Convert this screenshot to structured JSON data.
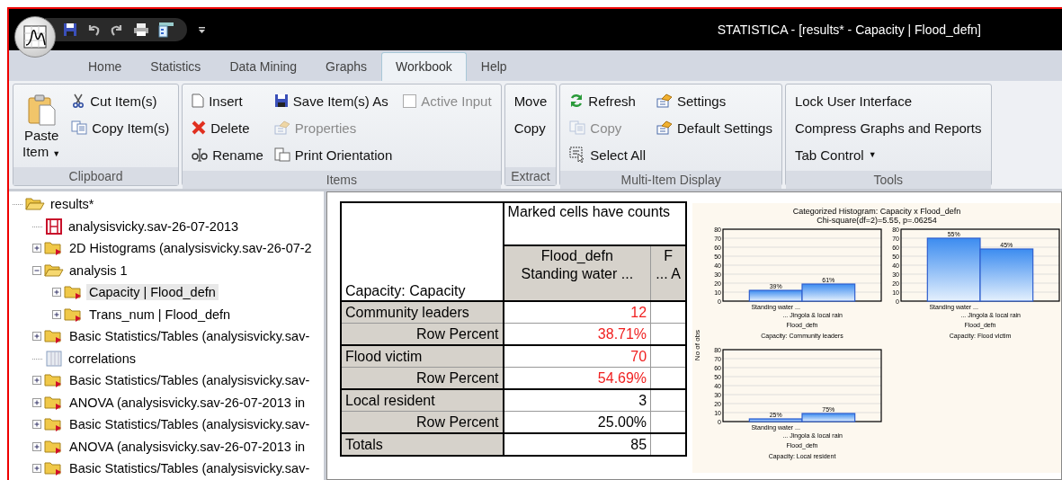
{
  "window": {
    "title": "STATISTICA - [results* - Capacity | Flood_defn]"
  },
  "quick_access": [
    {
      "kind": "save"
    },
    {
      "kind": "undo"
    },
    {
      "kind": "redo"
    },
    {
      "kind": "print"
    },
    {
      "kind": "panel"
    },
    {
      "kind": "customize"
    }
  ],
  "tabs": [
    {
      "label": "Home",
      "selected": false
    },
    {
      "label": "Statistics",
      "selected": false
    },
    {
      "label": "Data Mining",
      "selected": false
    },
    {
      "label": "Graphs",
      "selected": false
    },
    {
      "label": "Workbook",
      "selected": true
    },
    {
      "label": "Help",
      "selected": false
    }
  ],
  "ribbon": [
    {
      "label": "Clipboard",
      "columns": [
        [
          {
            "label": "Paste Item",
            "kind": "paste",
            "caret": "▼",
            "disabled": false
          }
        ],
        [
          {
            "label": "Cut Item(s)",
            "kind": "cut",
            "disabled": false
          },
          {
            "label": "Copy Item(s)",
            "kind": "copy",
            "disabled": false
          }
        ]
      ]
    },
    {
      "label": "Items",
      "columns": [
        [
          {
            "label": "Insert",
            "kind": "page",
            "disabled": false
          },
          {
            "label": "Delete",
            "kind": "delete",
            "disabled": false
          },
          {
            "label": "Rename",
            "kind": "rename",
            "disabled": false
          }
        ],
        [
          {
            "label": "Save Item(s) As",
            "kind": "save",
            "disabled": false
          },
          {
            "label": "Properties",
            "kind": "settings",
            "disabled": true
          },
          {
            "label": "Print Orientation",
            "kind": "pages",
            "disabled": false
          }
        ],
        [
          {
            "label": "Active Input",
            "kind": "checkbox",
            "checked": false,
            "disabled": true
          }
        ]
      ]
    },
    {
      "label": "Extract",
      "columns": [
        [
          {
            "label": "Move",
            "kind": "text",
            "disabled": false
          },
          {
            "label": "Copy",
            "kind": "text",
            "disabled": false
          }
        ]
      ]
    },
    {
      "label": "Multi-Item Display",
      "columns": [
        [
          {
            "label": "Refresh",
            "kind": "refresh",
            "disabled": false
          },
          {
            "label": "Copy",
            "kind": "copy",
            "disabled": true
          },
          {
            "label": "Select All",
            "kind": "select",
            "disabled": false
          }
        ],
        [
          {
            "label": "Settings",
            "kind": "settings",
            "disabled": false
          },
          {
            "label": "Default Settings",
            "kind": "settings",
            "disabled": false
          }
        ]
      ]
    },
    {
      "label": "Tools",
      "columns": [
        [
          {
            "label": "Lock User Interface",
            "kind": "text",
            "disabled": false
          },
          {
            "label": "Compress Graphs and Reports",
            "kind": "text",
            "disabled": false
          },
          {
            "label": "Tab Control",
            "kind": "dropdown",
            "caret": "▼",
            "disabled": false
          }
        ]
      ]
    }
  ],
  "tree": [
    {
      "label": "results*",
      "kind": "open-folder",
      "selected": false,
      "children": [
        {
          "label": "analysisvicky.sav-26-07-2013",
          "kind": "data",
          "selected": false
        },
        {
          "label": "2D Histograms (analysisvicky.sav-26-07-2",
          "kind": "folder",
          "expanded": false,
          "selected": false
        },
        {
          "label": "analysis 1",
          "kind": "open-folder",
          "expanded": true,
          "selected": false,
          "children": [
            {
              "label": "Capacity | Flood_defn",
              "kind": "folder",
              "expanded": false,
              "selected": true
            },
            {
              "label": "Trans_num | Flood_defn",
              "kind": "folder",
              "expanded": false,
              "selected": false
            }
          ]
        },
        {
          "label": "Basic Statistics/Tables (analysisvicky.sav-",
          "kind": "folder",
          "expanded": false,
          "selected": false
        },
        {
          "label": "correlations",
          "kind": "spreadsheet",
          "selected": false
        },
        {
          "label": "Basic Statistics/Tables (analysisvicky.sav-",
          "kind": "folder",
          "expanded": false,
          "selected": false
        },
        {
          "label": "ANOVA (analysisvicky.sav-26-07-2013 in",
          "kind": "folder",
          "expanded": false,
          "selected": false
        },
        {
          "label": "Basic Statistics/Tables (analysisvicky.sav-",
          "kind": "folder",
          "expanded": false,
          "selected": false
        },
        {
          "label": "ANOVA (analysisvicky.sav-26-07-2013 in",
          "kind": "folder",
          "expanded": false,
          "selected": false
        },
        {
          "label": "Basic Statistics/Tables (analysisvicky.sav-",
          "kind": "folder",
          "expanded": false,
          "selected": false
        }
      ]
    }
  ],
  "table": {
    "corner": "Capacity: Capacity",
    "note": "Marked cells have counts",
    "columns": [
      [
        "Flood_defn",
        "Standing water ..."
      ],
      [
        "F",
        "... A"
      ]
    ],
    "rows": [
      {
        "label": "Community leaders",
        "kind": "category",
        "value": "12",
        "marked": true
      },
      {
        "label": "Row Percent",
        "kind": "percent",
        "value": "38.71%",
        "marked": true
      },
      {
        "label": "Flood victim",
        "kind": "category",
        "value": "70",
        "marked": true
      },
      {
        "label": "Row Percent",
        "kind": "percent",
        "value": "54.69%",
        "marked": true
      },
      {
        "label": "Local resident",
        "kind": "category",
        "value": "3",
        "marked": false
      },
      {
        "label": "Row Percent",
        "kind": "percent",
        "value": "25.00%",
        "marked": false
      },
      {
        "label": "Totals",
        "kind": "category",
        "value": "85",
        "marked": false
      }
    ]
  },
  "histogram": {
    "title": "Categorized Histogram: Capacity x Flood_defn",
    "subtitle": "Chi-square(df=2)=5.55, p=.06254",
    "ylabel": "No of obs",
    "panels": [
      {
        "bar_labels": [
          "39%",
          "61%"
        ],
        "chart_data": {
          "type": "bar",
          "title": "Capacity: Community leaders",
          "xlabel": "Flood_defn",
          "categories": [
            "Standing water ...",
            "... Jingola & local rain"
          ],
          "values": [
            12,
            19
          ],
          "yticks": [
            0,
            10,
            20,
            30,
            40,
            50,
            60,
            70,
            80
          ],
          "ylim": [
            0,
            80
          ],
          "grid": true
        }
      },
      {
        "bar_labels": [
          "55%",
          "45%"
        ],
        "chart_data": {
          "type": "bar",
          "title": "Capacity: Flood victim",
          "xlabel": "Flood_defn",
          "categories": [
            "Standing water ...",
            "... Jingola & local rain"
          ],
          "values": [
            70,
            58
          ],
          "yticks": [
            0,
            10,
            20,
            30,
            40,
            50,
            60,
            70,
            80
          ],
          "ylim": [
            0,
            80
          ],
          "grid": true
        }
      },
      {
        "bar_labels": [
          "25%",
          "75%"
        ],
        "chart_data": {
          "type": "bar",
          "title": "Capacity: Local resident",
          "xlabel": "Flood_defn",
          "categories": [
            "Standing water ...",
            "... Jingola & local rain"
          ],
          "values": [
            3,
            9
          ],
          "yticks": [
            0,
            10,
            20,
            30,
            40,
            50,
            60,
            70,
            80
          ],
          "ylim": [
            0,
            80
          ],
          "grid": true
        }
      }
    ]
  }
}
